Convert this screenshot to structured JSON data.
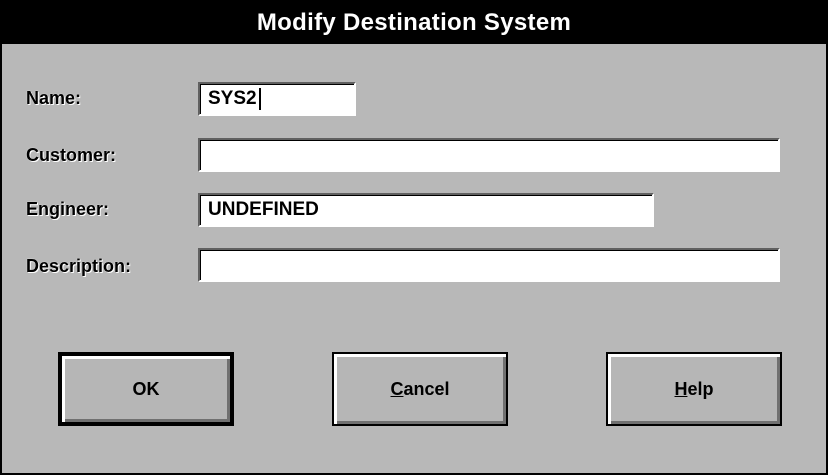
{
  "window": {
    "title": "Modify Destination System"
  },
  "fields": {
    "name": {
      "label": "Name:",
      "value": "SYS2"
    },
    "customer": {
      "label": "Customer:",
      "value": ""
    },
    "engineer": {
      "label": "Engineer:",
      "value": "UNDEFINED"
    },
    "description": {
      "label": "Description:",
      "value": ""
    }
  },
  "buttons": {
    "ok": {
      "label": "OK"
    },
    "cancel": {
      "mnemonic": "C",
      "rest": "ancel"
    },
    "help": {
      "mnemonic": "H",
      "rest": "elp"
    }
  }
}
